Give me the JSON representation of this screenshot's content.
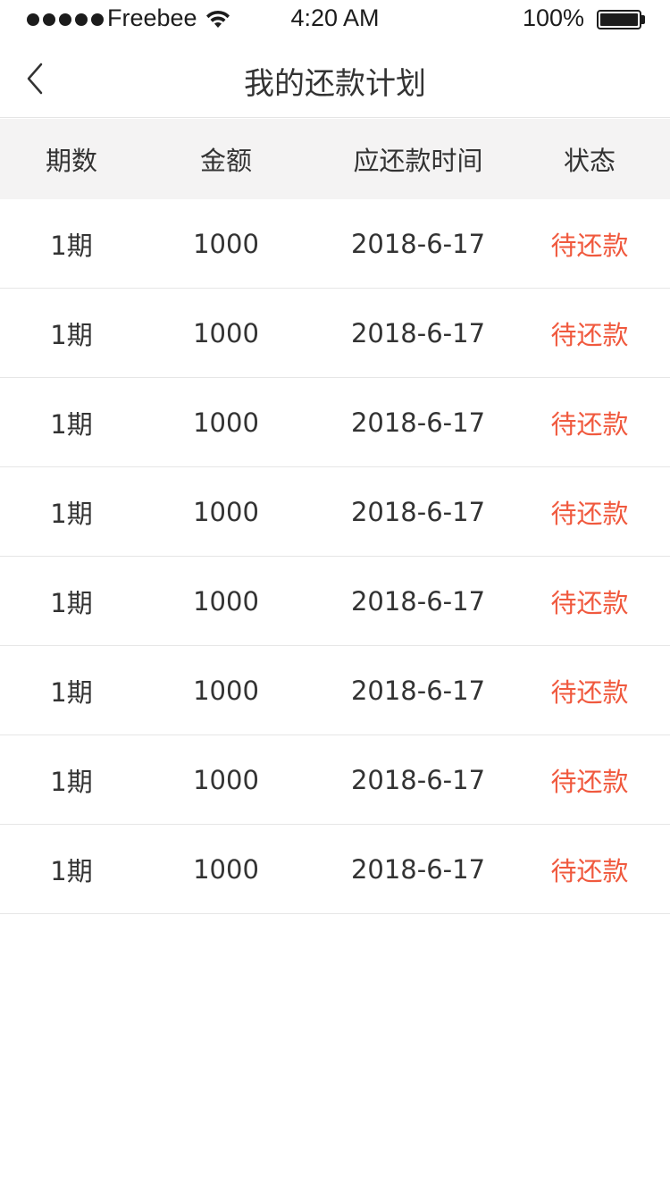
{
  "status_bar": {
    "carrier": "Freebee",
    "time": "4:20 AM",
    "battery_percent": "100%",
    "signal_bars": 5,
    "battery_level": 1.0
  },
  "nav": {
    "title": "我的还款计划",
    "back_icon": "chevron-left-icon"
  },
  "table": {
    "headers": [
      "期数",
      "金额",
      "应还款时间",
      "状态"
    ],
    "rows": [
      {
        "period": "1期",
        "amount": "1000",
        "due_date": "2018-6-17",
        "status": "待还款"
      },
      {
        "period": "1期",
        "amount": "1000",
        "due_date": "2018-6-17",
        "status": "待还款"
      },
      {
        "period": "1期",
        "amount": "1000",
        "due_date": "2018-6-17",
        "status": "待还款"
      },
      {
        "period": "1期",
        "amount": "1000",
        "due_date": "2018-6-17",
        "status": "待还款"
      },
      {
        "period": "1期",
        "amount": "1000",
        "due_date": "2018-6-17",
        "status": "待还款"
      },
      {
        "period": "1期",
        "amount": "1000",
        "due_date": "2018-6-17",
        "status": "待还款"
      },
      {
        "period": "1期",
        "amount": "1000",
        "due_date": "2018-6-17",
        "status": "待还款"
      },
      {
        "period": "1期",
        "amount": "1000",
        "due_date": "2018-6-17",
        "status": "待还款"
      }
    ]
  },
  "colors": {
    "status_pending": "#f0593e",
    "header_bg": "#f4f3f3",
    "text": "#333333"
  }
}
